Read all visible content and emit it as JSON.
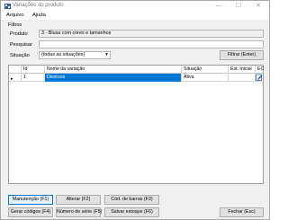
{
  "window": {
    "title": "Variações do produto",
    "controls": {
      "minimize": "—",
      "maximize": "☐",
      "close": "✕"
    }
  },
  "menu": {
    "items": [
      "Arquivo",
      "Ajuda"
    ]
  },
  "filters": {
    "group_label": "Filtros",
    "produto_label": "Produto",
    "produto_value": "3 - Blusa com cores e tamanhos",
    "pesquisar_label": "Pesquisar",
    "pesquisar_value": "",
    "situacao_label": "Situação",
    "situacao_value": "(todas as situações)",
    "filter_button": "Filtrar (Enter)"
  },
  "grid": {
    "columns": [
      "",
      "Id",
      "Nome da variação",
      "Situação",
      "Est. Inicial",
      "EC"
    ],
    "rows": [
      {
        "indicator": "▸",
        "id": "1",
        "nome": "Diversos",
        "situacao": "Ativa",
        "estoque_inicial": "",
        "ec_icon": "edit-icon"
      }
    ]
  },
  "buttons": {
    "row1": [
      "Manutenção (F1)",
      "Alterar (F2)",
      "Cód. de barras (F3)"
    ],
    "row2": [
      "Gerar códigos (F4)",
      "Número de série (F5)",
      "Salvar estoque (F6)"
    ],
    "close": "Fechar (Esc)"
  },
  "colors": {
    "selection": "#0078d7",
    "focus_border": "#0078d7"
  }
}
